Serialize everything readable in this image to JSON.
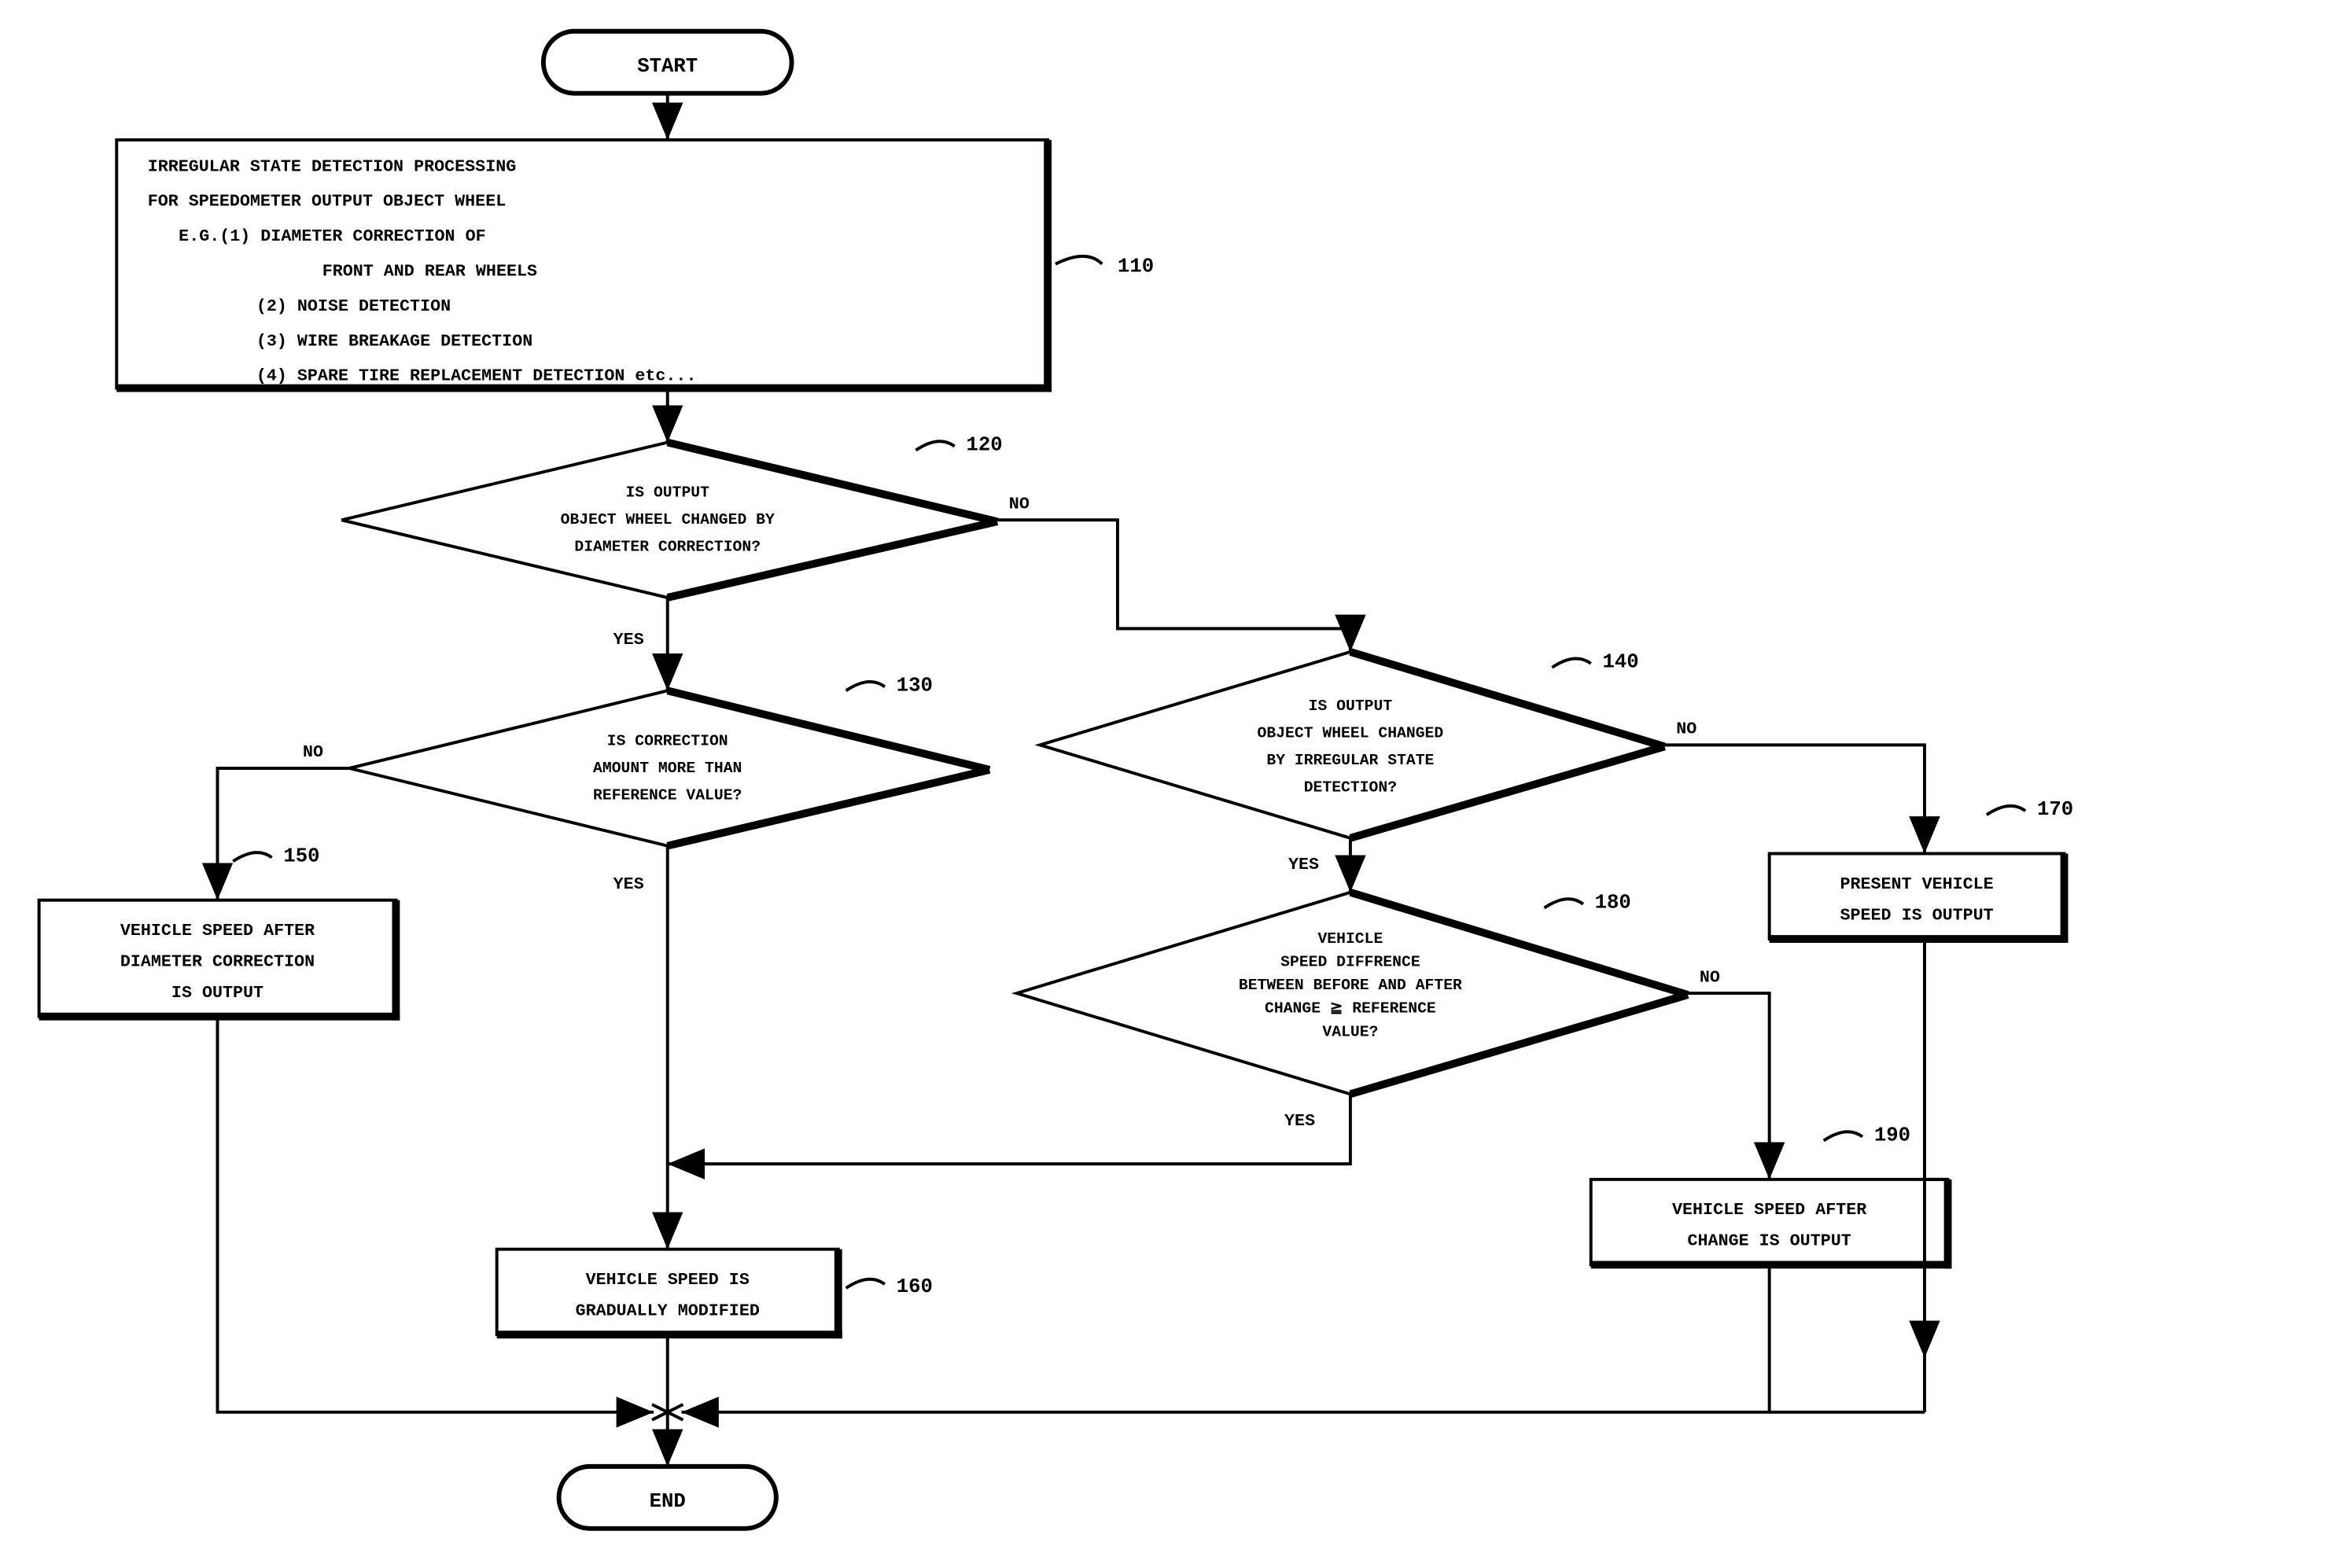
{
  "flowchart": {
    "start": "START",
    "end": "END",
    "nodes": {
      "110": {
        "ref": "110",
        "lines": [
          "IRREGULAR STATE DETECTION PROCESSING",
          "FOR SPEEDOMETER OUTPUT OBJECT WHEEL",
          "  E.G.(1) DIAMETER CORRECTION OF",
          "          FRONT AND REAR WHEELS",
          "      (2) NOISE DETECTION",
          "      (3) WIRE BREAKAGE DETECTION",
          "      (4) SPARE TIRE REPLACEMENT DETECTION etc..."
        ]
      },
      "120": {
        "ref": "120",
        "lines": [
          "IS OUTPUT",
          "OBJECT WHEEL CHANGED BY",
          "DIAMETER CORRECTION?"
        ],
        "yes": "YES",
        "no": "NO"
      },
      "130": {
        "ref": "130",
        "lines": [
          "IS CORRECTION",
          "AMOUNT MORE THAN",
          "REFERENCE VALUE?"
        ],
        "yes": "YES",
        "no": "NO"
      },
      "140": {
        "ref": "140",
        "lines": [
          "IS OUTPUT",
          "OBJECT WHEEL CHANGED",
          "BY IRREGULAR STATE",
          "DETECTION?"
        ],
        "yes": "YES",
        "no": "NO"
      },
      "150": {
        "ref": "150",
        "lines": [
          "VEHICLE SPEED AFTER",
          "DIAMETER CORRECTION",
          "IS OUTPUT"
        ]
      },
      "160": {
        "ref": "160",
        "lines": [
          "VEHICLE SPEED IS",
          "GRADUALLY MODIFIED"
        ]
      },
      "170": {
        "ref": "170",
        "lines": [
          "PRESENT VEHICLE",
          "SPEED IS OUTPUT"
        ]
      },
      "180": {
        "ref": "180",
        "lines": [
          "VEHICLE",
          "SPEED DIFFRENCE",
          "BETWEEN BEFORE AND AFTER",
          "CHANGE ≧ REFERENCE",
          "VALUE?"
        ],
        "yes": "YES",
        "no": "NO"
      },
      "190": {
        "ref": "190",
        "lines": [
          "VEHICLE SPEED AFTER",
          "CHANGE IS OUTPUT"
        ]
      }
    }
  }
}
